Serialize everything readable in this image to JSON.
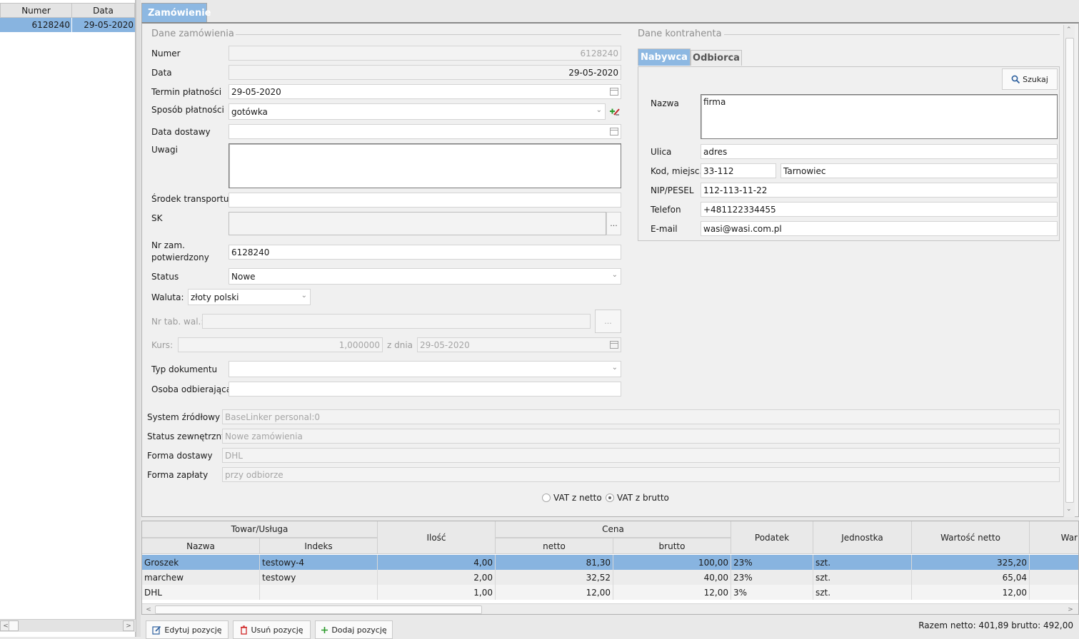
{
  "left_list": {
    "col_numer": "Numer",
    "col_data": "Data",
    "row_numer": "6128240",
    "row_data": "29-05-2020"
  },
  "tab_title": "Zamówienie",
  "dane_zamowienia": {
    "title": "Dane zamówienia",
    "numer_label": "Numer",
    "numer_value": "6128240",
    "data_label": "Data",
    "data_value": "29-05-2020",
    "termin_label": "Termin płatności",
    "termin_value": "29-05-2020",
    "sposob_label": "Sposób płatności",
    "sposob_value": "gotówka",
    "dostawa_label": "Data dostawy",
    "dostawa_value": "",
    "uwagi_label": "Uwagi",
    "uwagi_value": "",
    "transport_label": "Środek transportu",
    "transport_value": "",
    "sk_label": "SK",
    "sk_button": "...",
    "nrzam_label_1": "Nr zam.",
    "nrzam_label_2": "potwierdzony",
    "nrzam_value": "6128240",
    "status_label": "Status",
    "status_value": "Nowe",
    "waluta_label": "Waluta:",
    "waluta_value": "złoty polski",
    "nrtab_label": "Nr tab. wal.:",
    "nrtab_value": "",
    "nrtab_button": "...",
    "kurs_label": "Kurs:",
    "kurs_value": "1,000000",
    "zdnia_label": "z dnia",
    "zdnia_value": "29-05-2020",
    "typ_label": "Typ dokumentu",
    "typ_value": "",
    "osoba_label": "Osoba odbierająca",
    "osoba_value": ""
  },
  "dane_kontrahenta": {
    "title": "Dane kontrahenta",
    "tab_nabywca": "Nabywca",
    "tab_odbiorca": "Odbiorca",
    "szukaj_button": "Szukaj",
    "nazwa_label": "Nazwa",
    "nazwa_value": "firma",
    "ulica_label": "Ulica",
    "ulica_value": "adres",
    "kod_label": "Kod, miejsc.",
    "kod_value": "33-112",
    "miejsc_value": "Tarnowiec",
    "nip_label": "NIP/PESEL",
    "nip_value": "112-113-11-22",
    "telefon_label": "Telefon",
    "telefon_value": "+481122334455",
    "email_label": "E-mail",
    "email_value": "wasi@wasi.com.pl"
  },
  "extra": {
    "system_label": "System źródłowy",
    "system_value": "BaseLinker personal:0",
    "status_zew_label": "Status zewnętrzny",
    "status_zew_value": "Nowe zamówienia",
    "forma_dostawy_label": "Forma dostawy",
    "forma_dostawy_value": "DHL",
    "forma_zaplaty_label": "Forma zapłaty",
    "forma_zaplaty_value": "przy odbiorze"
  },
  "vat": {
    "netto_label": "VAT z netto",
    "brutto_label": "VAT z brutto",
    "selected": "brutto"
  },
  "table": {
    "group_towar": "Towar/Usługa",
    "col_nazwa": "Nazwa",
    "col_indeks": "Indeks",
    "col_ilosc": "Ilość",
    "group_cena": "Cena",
    "col_netto": "netto",
    "col_brutto": "brutto",
    "col_podatek": "Podatek",
    "col_jednostka": "Jednostka",
    "col_wartosc_netto": "Wartość netto",
    "col_war": "War",
    "rows": [
      {
        "nazwa": "Groszek",
        "indeks": "testowy-4",
        "ilosc": "4,00",
        "netto": "81,30",
        "brutto": "100,00",
        "podatek": "23%",
        "jednostka": "szt.",
        "wartosc": "325,20"
      },
      {
        "nazwa": "marchew",
        "indeks": "testowy",
        "ilosc": "2,00",
        "netto": "32,52",
        "brutto": "40,00",
        "podatek": "23%",
        "jednostka": "szt.",
        "wartosc": "65,04"
      },
      {
        "nazwa": "DHL",
        "indeks": "",
        "ilosc": "1,00",
        "netto": "12,00",
        "brutto": "12,00",
        "podatek": "3%",
        "jednostka": "szt.",
        "wartosc": "12,00"
      }
    ]
  },
  "buttons": {
    "edytuj": "Edytuj pozycję",
    "usun": "Usuń pozycję",
    "dodaj": "Dodaj pozycję"
  },
  "summary": "Razem netto: 401,89 brutto: 492,00"
}
